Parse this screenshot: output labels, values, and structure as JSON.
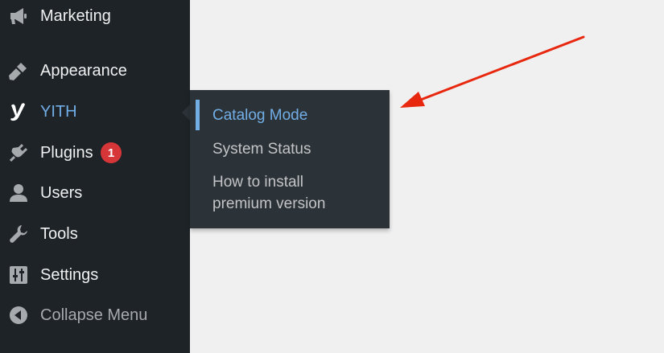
{
  "sidebar": {
    "items": [
      {
        "label": "Marketing",
        "icon": "megaphone-icon"
      },
      {
        "label": "Appearance",
        "icon": "paintbrush-icon"
      },
      {
        "label": "YITH",
        "icon": "yith-logo-icon",
        "current": true
      },
      {
        "label": "Plugins",
        "icon": "plugin-icon",
        "badge": "1"
      },
      {
        "label": "Users",
        "icon": "user-icon"
      },
      {
        "label": "Tools",
        "icon": "wrench-icon"
      },
      {
        "label": "Settings",
        "icon": "settings-sliders-icon"
      },
      {
        "label": "Collapse Menu",
        "icon": "collapse-icon"
      }
    ]
  },
  "flyout": {
    "items": [
      {
        "label": "Catalog Mode",
        "current": true
      },
      {
        "label": "System Status"
      },
      {
        "label": "How to install"
      },
      {
        "label": "premium version"
      }
    ]
  },
  "colors": {
    "sidebar_bg": "#1d2327",
    "submenu_bg": "#2c3338",
    "accent": "#72aee6",
    "badge": "#d63638",
    "annotation_arrow": "#e8270f"
  }
}
